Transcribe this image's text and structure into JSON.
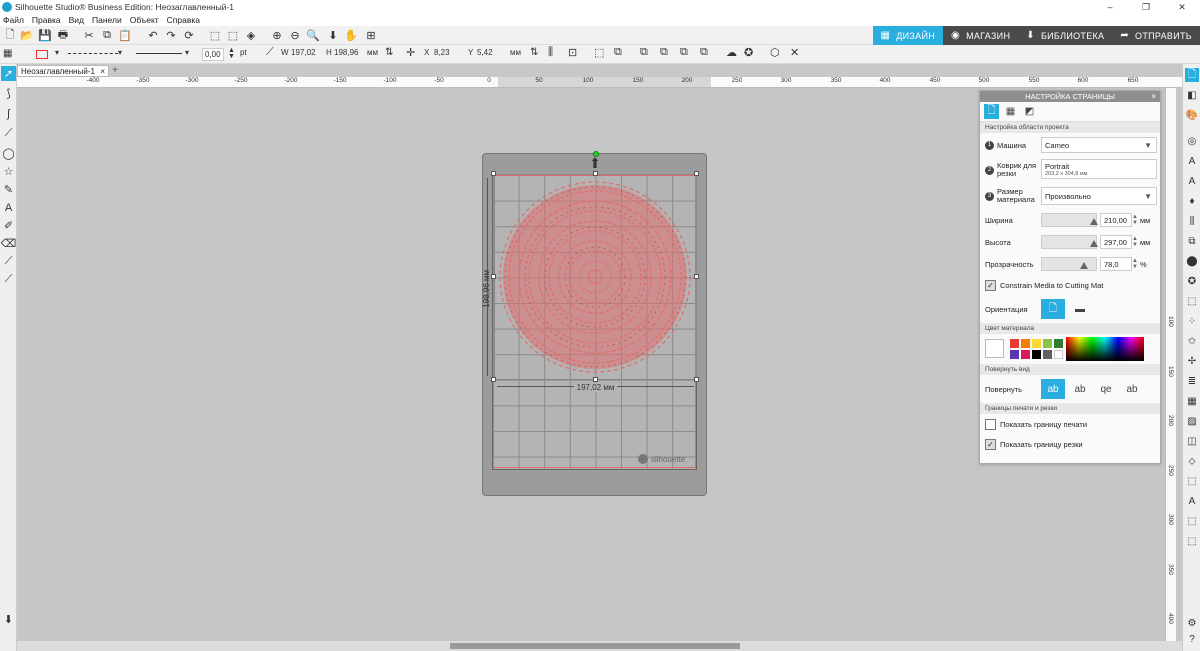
{
  "window": {
    "title": "Silhouette Studio® Business Edition: Неозаглавленный-1",
    "minimize": "–",
    "maximize": "❐",
    "close": "✕"
  },
  "menu": [
    "Файл",
    "Правка",
    "Вид",
    "Панели",
    "Объект",
    "Справка"
  ],
  "nav_tabs": [
    {
      "label": "ДИЗАЙН",
      "icon": "grid-icon",
      "active": true
    },
    {
      "label": "МАГАЗИН",
      "icon": "store-icon",
      "active": false
    },
    {
      "label": "БИБЛИОТЕКА",
      "icon": "download-icon",
      "active": false
    },
    {
      "label": "ОТПРАВИТЬ",
      "icon": "send-icon",
      "active": false
    }
  ],
  "toolbar2": {
    "line_width": "0,00",
    "line_width_unit": "pt",
    "w_label": "W",
    "w_value": "197,02",
    "h_label": "H",
    "h_value": "198,96",
    "size_unit": "мм",
    "x_label": "X",
    "x_value": "8,23",
    "y_label": "Y",
    "y_value": "5,42",
    "pos_unit": "мм"
  },
  "document_tab": {
    "name": "Неозаглавленный-1",
    "close": "×",
    "add": "+"
  },
  "ruler_h": [
    "-400",
    "-350",
    "-300",
    "-250",
    "-200",
    "-150",
    "-100",
    "-50",
    "0",
    "50",
    "100",
    "150",
    "200",
    "250",
    "300",
    "350",
    "400",
    "450",
    "500",
    "550",
    "600",
    "650"
  ],
  "ruler_v": [
    "100",
    "150",
    "200",
    "250",
    "300",
    "350",
    "400"
  ],
  "mat": {
    "logo": "silhouette",
    "width_label": "197,02 мм",
    "height_label": "198,96 мм"
  },
  "panel": {
    "title": "НАСТРОЙКА СТРАНИЦЫ",
    "close": "×",
    "section_area": "Настройка области проекта",
    "machine_label": "Машина",
    "machine_value": "Cameo",
    "mat_label": "Коврик для резки",
    "mat_value": "Portrait",
    "mat_size": "203,2 x 304,8 мм",
    "media_label": "Размер материала",
    "media_value": "Произвольно",
    "width_label": "Ширина",
    "width_value": "210,00",
    "width_unit": "мм",
    "height_label": "Высота",
    "height_value": "297,00",
    "height_unit": "мм",
    "transparency_label": "Прозрачность",
    "transparency_value": "78,0",
    "transparency_unit": "%",
    "constrain_label": "Constrain Media to Cutting Mat",
    "constrain_checked": true,
    "orientation_label": "Ориентация",
    "section_color": "Цвет материала",
    "swatches": [
      "#ffffff",
      "#e53935",
      "#f57c00",
      "#fdd835",
      "#8bc34a",
      "#2e7d32",
      "#1e88e5",
      "#5e35b1",
      "#d81b60",
      "#000000",
      "#616161",
      "#ffffff"
    ],
    "section_rotate": "Повернуть вид",
    "rotate_label": "Повернуть",
    "section_bounds": "Границы печати и резки",
    "show_print_label": "Показать границу печати",
    "show_print_checked": false,
    "show_cut_label": "Показать границу резки",
    "show_cut_checked": true
  },
  "colors": {
    "accent": "#29aee0",
    "mat": "#9c9c9c",
    "design": "#e07070"
  }
}
